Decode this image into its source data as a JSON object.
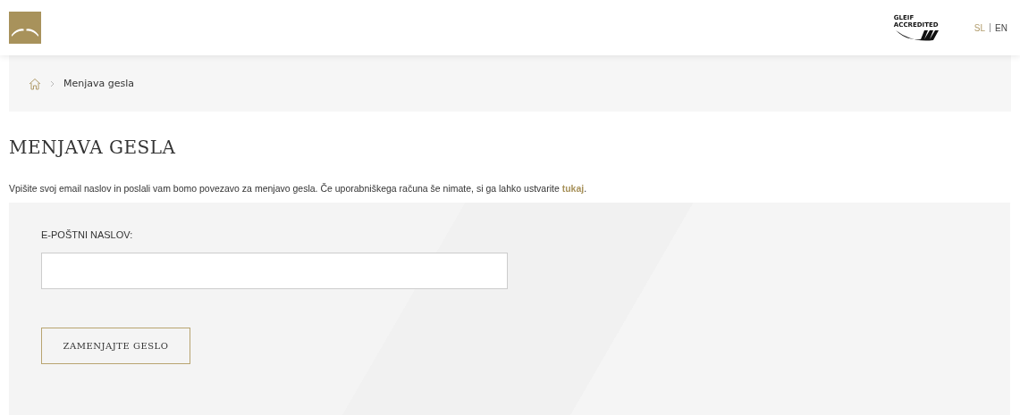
{
  "header": {
    "badge_text": [
      "GLEIF",
      "ACCREDITED"
    ],
    "languages": [
      {
        "label": "SL",
        "selected": true
      },
      {
        "label": "EN",
        "selected": false
      }
    ]
  },
  "breadcrumb": {
    "items": [
      "Menjava gesla"
    ]
  },
  "title": "MENJAVA GESLA",
  "intro": {
    "before": "Vpišite svoj email naslov in poslali vam bomo povezavo za menjavo gesla. Če uporabniškega računa še nimate, si ga lahko ustvarite ",
    "link": "tukaj",
    "after": "."
  },
  "form": {
    "email_label": "E-POŠTNI NASLOV:",
    "submit": "ZAMENJAJTE GESLO"
  }
}
